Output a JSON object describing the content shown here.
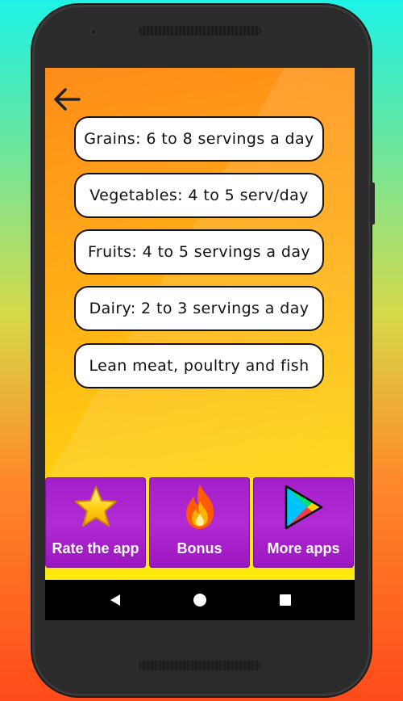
{
  "app": {
    "back_icon": "arrow-left-icon",
    "items": [
      {
        "label": "Grains: 6 to 8 servings a day"
      },
      {
        "label": "Vegetables: 4 to 5 serv/day"
      },
      {
        "label": "Fruits: 4 to 5 servings a day"
      },
      {
        "label": "Dairy: 2 to 3 servings a day"
      },
      {
        "label": "Lean meat, poultry and fish"
      }
    ],
    "bottom_actions": [
      {
        "label": "Rate the app",
        "icon": "star-icon"
      },
      {
        "label": "Bonus",
        "icon": "flame-icon"
      },
      {
        "label": "More apps",
        "icon": "play-store-icon"
      }
    ]
  },
  "system_nav": {
    "back": "back-triangle-icon",
    "home": "home-circle-icon",
    "recents": "recents-square-icon"
  },
  "colors": {
    "screen_top": "#ff8c1a",
    "screen_bottom": "#ffe10e",
    "tile_purple": "#a21fc8",
    "border": "#111111"
  }
}
